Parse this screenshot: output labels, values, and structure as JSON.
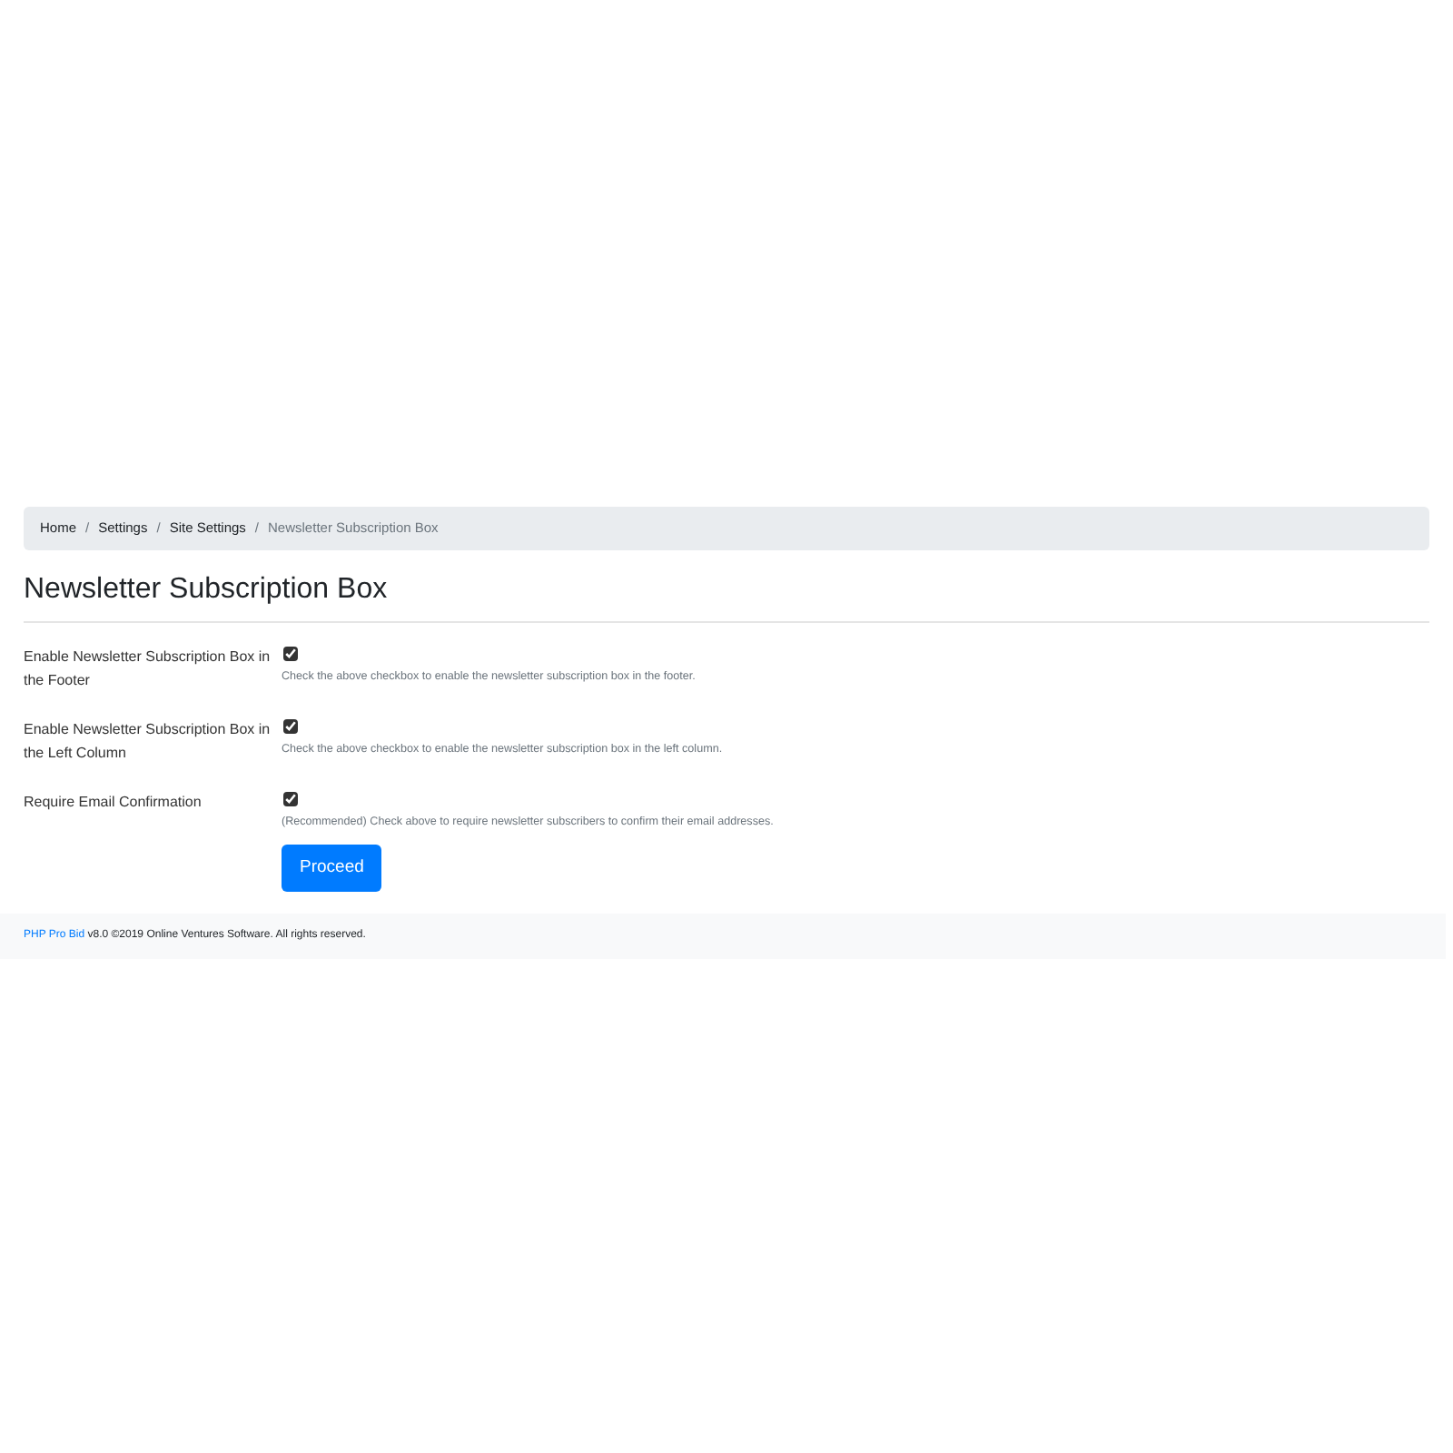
{
  "breadcrumb_separator": "/",
  "breadcrumb": [
    {
      "label": "Home",
      "current": false
    },
    {
      "label": "Settings",
      "current": false
    },
    {
      "label": "Site Settings",
      "current": false
    },
    {
      "label": "Newsletter Subscription Box",
      "current": true
    }
  ],
  "title": "Newsletter Subscription Box",
  "settings": [
    {
      "label": "Enable Newsletter Subscription Box in the Footer",
      "checked": true,
      "help": "Check the above checkbox to enable the newsletter subscription box in the footer."
    },
    {
      "label": "Enable Newsletter Subscription Box in the Left Column",
      "checked": true,
      "help": "Check the above checkbox to enable the newsletter subscription box in the left column."
    },
    {
      "label": "Require Email Confirmation",
      "checked": true,
      "help": "(Recommended) Check above to require newsletter subscribers to confirm their email addresses."
    }
  ],
  "submit_button": "Proceed",
  "footer": {
    "link": "PHP Pro Bid",
    "text": "v8.0 ©2019 Online Ventures Software. All rights reserved."
  }
}
